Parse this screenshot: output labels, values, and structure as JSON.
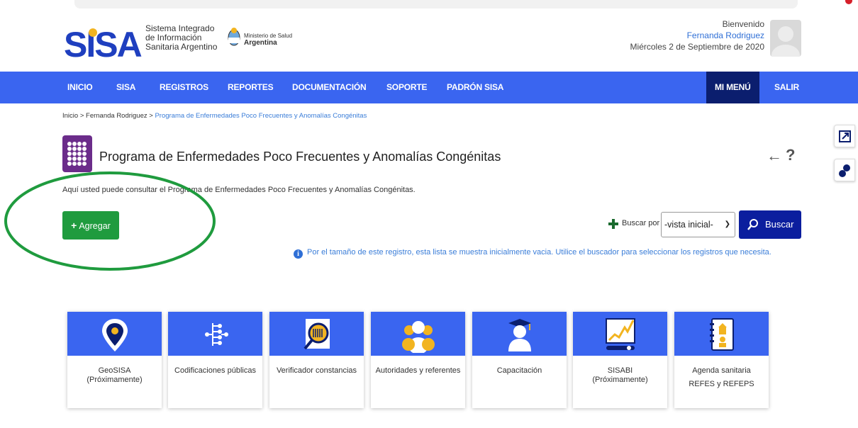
{
  "header": {
    "logo_text": "SISA",
    "logo_subtitle_lines": [
      "Sistema Integrado",
      "de Información",
      "Sanitaria Argentino"
    ],
    "ministerio_line1": "Ministerio de Salud",
    "ministerio_line2": "Argentina",
    "welcome": "Bienvenido",
    "user_name": "Fernanda Rodriguez",
    "date": "Miércoles 2 de Septiembre de 2020"
  },
  "nav": {
    "items": [
      "INICIO",
      "SISA",
      "REGISTROS",
      "REPORTES",
      "DOCUMENTACIÓN",
      "SOPORTE",
      "PADRÓN SISA"
    ],
    "mi_menu": "MI MENÚ",
    "salir": "SALIR"
  },
  "breadcrumb": {
    "home": "Inicio",
    "sep": " > ",
    "user": "Fernanda Rodriguez",
    "current": "Programa de Enfermedades Poco Frecuentes y Anomalías Congénitas"
  },
  "page": {
    "title": "Programa de Enfermedades Poco Frecuentes y Anomalías Congénitas",
    "subtitle": "Aquí usted puede consultar el Programa de Enfermedades Poco Frecuentes y Anomalías Congénitas.",
    "back_glyph": "←",
    "help_glyph": "?",
    "add_label": "Agregar"
  },
  "search": {
    "label": "Buscar por",
    "selected": "-vista inicial-",
    "button": "Buscar",
    "info": "Por el tamaño de este registro, esta lista se muestra inicialmente vacia. Utilice el buscador para seleccionar los registros que necesita."
  },
  "cards": [
    {
      "label": "GeoSISA",
      "label2": "(Próximamente)",
      "icon": "map-pin-icon"
    },
    {
      "label": "Codificaciones públicas",
      "label2": "",
      "icon": "tree-structure-icon"
    },
    {
      "label": "Verificador constancias",
      "label2": "",
      "icon": "magnifier-barcode-icon"
    },
    {
      "label": "Autoridades y referentes",
      "label2": "",
      "icon": "people-group-icon"
    },
    {
      "label": "Capacitación",
      "label2": "",
      "icon": "graduate-icon"
    },
    {
      "label": "SISABI",
      "label2": "(Próximamente)",
      "icon": "monitor-chart-icon"
    },
    {
      "label": "Agenda sanitaria",
      "label2": "REFES y REFEPS",
      "icon": "agenda-icon"
    }
  ],
  "colors": {
    "nav_blue": "#3a65f0",
    "mi_menu_dark": "#0b1e6e",
    "add_green": "#1f9b3e",
    "search_navy": "#0b1e9e",
    "highlight_ellipse": "#1f9b3e",
    "program_purple": "#6b2c8a"
  }
}
